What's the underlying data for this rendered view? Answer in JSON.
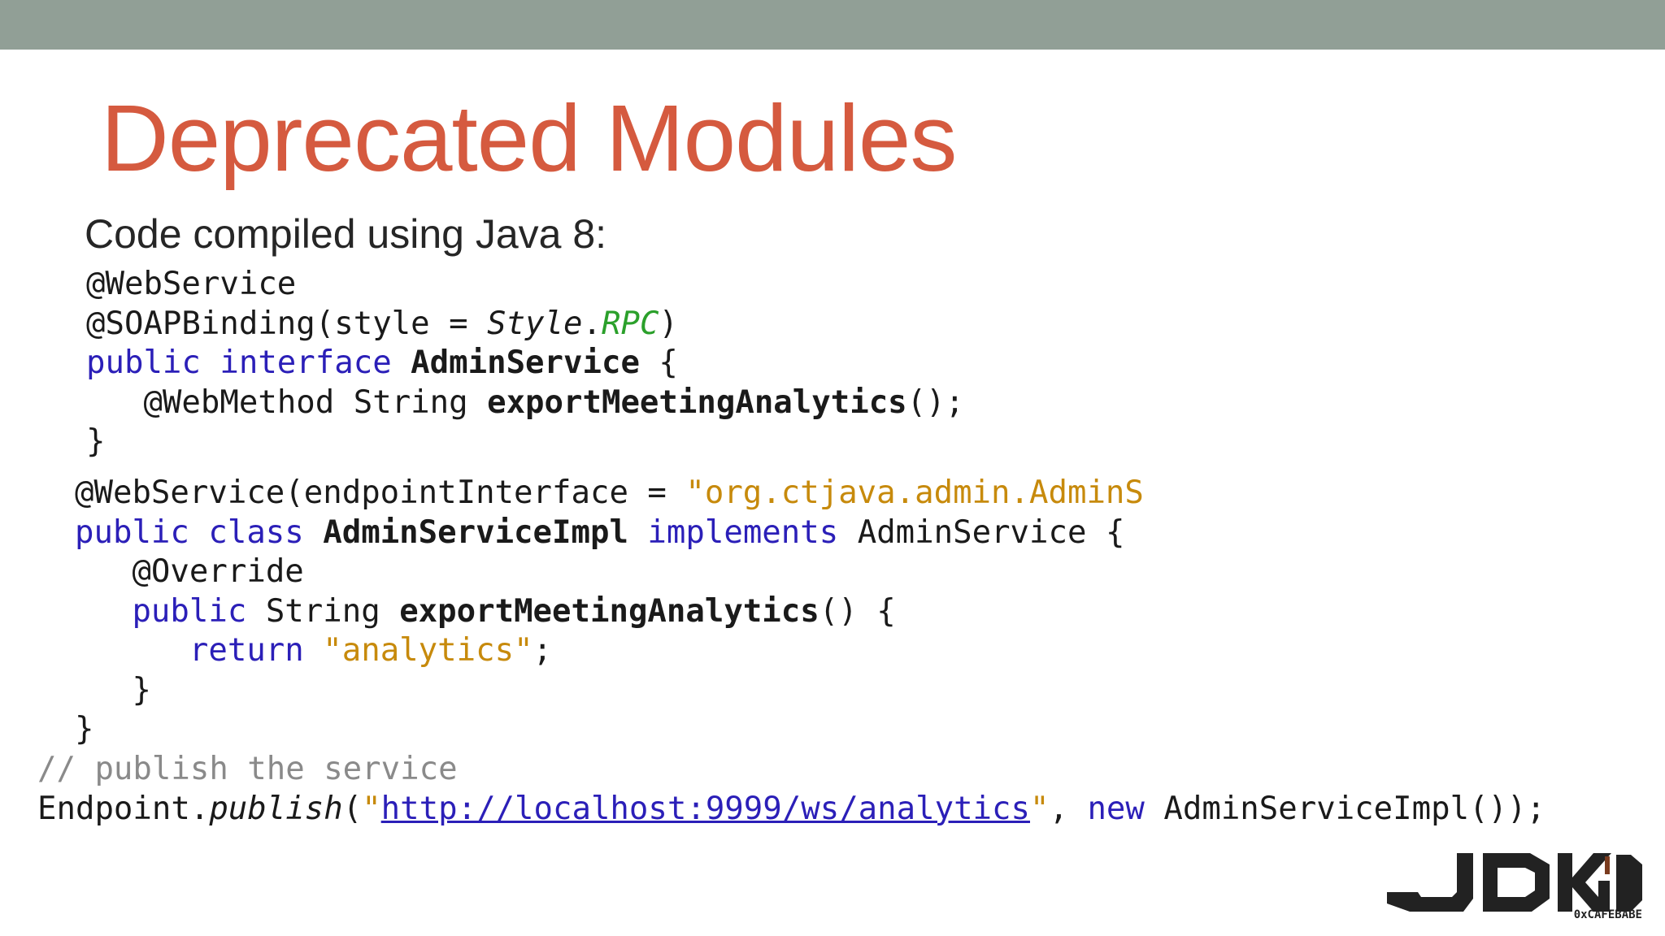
{
  "slide": {
    "title": "Deprecated Modules",
    "subtitle": "Code compiled using Java 8:"
  },
  "code_interface": {
    "l1_annotation": "@WebService",
    "l2_annotation": "@SOAPBinding(style = ",
    "l2_style": "Style",
    "l2_dot": ".",
    "l2_const": "RPC",
    "l2_close": ")",
    "l3_kw": "public interface",
    "l3_name": "AdminService",
    "l3_brace": " {",
    "l4_indent": "   ",
    "l4_annotation": "@WebMethod String ",
    "l4_method": "exportMeetingAnalytics",
    "l4_tail": "();",
    "l5_brace": "}"
  },
  "code_impl": {
    "l1_annotation": "@WebService(endpointInterface = ",
    "l1_string": "\"org.ctjava.admin.AdminS",
    "l2_kw": "public class",
    "l2_name": "AdminServiceImpl",
    "l2_implements": "implements",
    "l2_tail": " AdminService {",
    "l3_indent": "   ",
    "l3_annotation": "@Override",
    "l4_indent": "   ",
    "l4_kw": "public",
    "l4_type": " String ",
    "l4_method": "exportMeetingAnalytics",
    "l4_tail": "() {",
    "l5_indent": "      ",
    "l5_kw": "return",
    "l5_string": "\"analytics\"",
    "l5_tail": ";",
    "l6_brace": "   }",
    "l7_brace": "}"
  },
  "code_publish": {
    "comment": "// publish the service",
    "l2_class": "Endpoint",
    "l2_dot": ".",
    "l2_method": "publish",
    "l2_open": "(",
    "l2_quote_open": "\"",
    "l2_url": "http://localhost:9999/ws/analytics",
    "l2_quote_close": "\"",
    "l2_comma": ", ",
    "l2_new": "new",
    "l2_tail": " AdminServiceImpl());"
  },
  "logo": {
    "wordmark": "JDKIO",
    "caption": "0xCAFEBABE"
  },
  "colors": {
    "title": "#d55a3f",
    "top_bar": "#919f96",
    "keyword": "#2b1fb8",
    "string": "#c78a0c",
    "constant": "#2ba02b",
    "comment": "#8a8a8a"
  }
}
